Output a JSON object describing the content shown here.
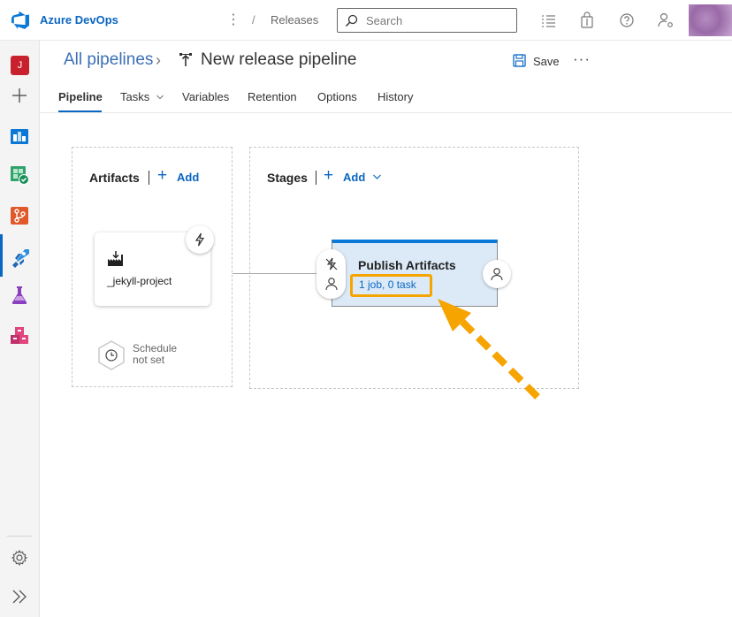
{
  "topbar": {
    "brand": "Azure DevOps",
    "breadcrumb_sep": "/",
    "breadcrumb_page": "Releases",
    "search_placeholder": "Search",
    "more_glyph": "⋮"
  },
  "rail": {
    "project_initial": "J",
    "items": [
      "add-icon",
      "boards-icon",
      "test-plans-check-icon",
      "repos-icon",
      "pipelines-icon",
      "test-flask-icon",
      "artifacts-icon"
    ],
    "settings": "settings-gear-icon",
    "expand": "expand-double-chevron-icon"
  },
  "header": {
    "all_pipelines": "All pipelines",
    "chevron": "›",
    "pipeline_name": "New release pipeline",
    "save_label": "Save",
    "more_actions": "···"
  },
  "tabs": [
    {
      "label": "Pipeline",
      "active": true
    },
    {
      "label": "Tasks",
      "has_dropdown": true
    },
    {
      "label": "Variables"
    },
    {
      "label": "Retention"
    },
    {
      "label": "Options"
    },
    {
      "label": "History"
    }
  ],
  "artifacts": {
    "title": "Artifacts",
    "add_label": "Add",
    "add_symbol": "+",
    "card_name": "_jekyll-project",
    "schedule_line1": "Schedule",
    "schedule_line2": "not set"
  },
  "stages": {
    "title": "Stages",
    "add_label": "Add",
    "add_symbol": "+",
    "stage_name": "Publish Artifacts",
    "stage_tasks": "1 job, 0 task"
  },
  "colors": {
    "accent": "#0a66c2",
    "stage_fill": "#dceaf7",
    "stage_top": "#0a78d4",
    "highlight": "#f6a400"
  }
}
